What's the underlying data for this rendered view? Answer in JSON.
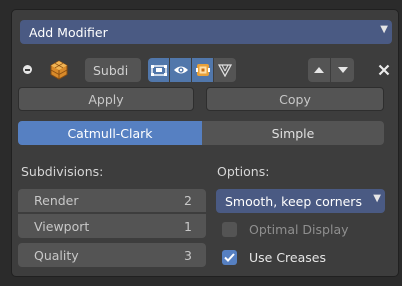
{
  "add_modifier": {
    "label": "Add Modifier",
    "chevron": "chevron-down-icon"
  },
  "modifier": {
    "name": "Subdi",
    "type_icon": "subdivision-modifier-icon",
    "toggles": [
      {
        "icon": "edit-mode-icon",
        "active": true
      },
      {
        "icon": "realtime-viewport-icon",
        "active": true
      },
      {
        "icon": "render-icon",
        "active": true
      },
      {
        "icon": "on-cage-icon",
        "active": false
      }
    ],
    "move_up_icon": "move-up-icon",
    "move_down_icon": "move-down-icon",
    "close_icon": "close-icon"
  },
  "actions": {
    "apply_label": "Apply",
    "copy_label": "Copy"
  },
  "algorithm": {
    "options": [
      "Catmull-Clark",
      "Simple"
    ],
    "selected": "Catmull-Clark"
  },
  "subdivisions": {
    "heading": "Subdivisions:",
    "render": {
      "label": "Render",
      "value": "2"
    },
    "viewport": {
      "label": "Viewport",
      "value": "1"
    },
    "quality": {
      "label": "Quality",
      "value": "3"
    }
  },
  "options": {
    "heading": "Options:",
    "uv_smooth": {
      "value": "Smooth, keep corners"
    },
    "optimal_display": {
      "label": "Optimal Display",
      "checked": false
    },
    "use_creases": {
      "label": "Use Creases",
      "checked": true
    }
  },
  "colors": {
    "panel_bg": "#3d3d3d",
    "button_bg": "#545454",
    "accent_blue": "#5680c2",
    "dropdown_blue": "#4a5a83"
  }
}
